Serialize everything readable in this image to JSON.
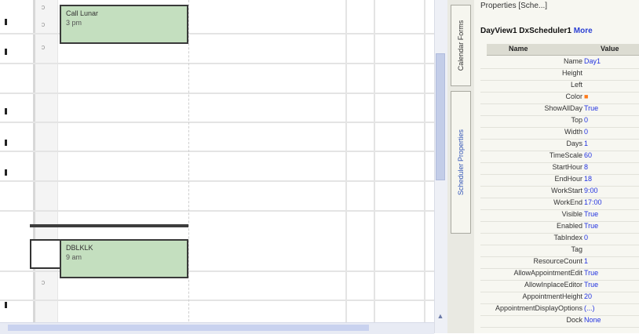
{
  "calendar": {
    "events": [
      {
        "title": "Call Lunar",
        "subtitle": "3 pm"
      },
      {
        "title": "DBLKLK",
        "subtitle": "9 am"
      }
    ],
    "time_glyphs": [
      "ↄ",
      "ↄ",
      "ↄ",
      "ↄ",
      "ↄ"
    ]
  },
  "tabs": {
    "tab1": "Calendar Forms",
    "tab2": "Scheduler Properties"
  },
  "panel": {
    "title": "Properties [Sche...] ",
    "header": "DayView1 DxScheduler1 ",
    "header_more": "More",
    "columns": [
      "Name",
      "Value"
    ],
    "rows": [
      {
        "k": "Name",
        "v": "Day1"
      },
      {
        "k": "Height",
        "v": ""
      },
      {
        "k": "Left",
        "v": ""
      },
      {
        "k": "Color",
        "v": "■"
      },
      {
        "k": "ShowAllDay",
        "v": "True"
      },
      {
        "k": "Top",
        "v": "0"
      },
      {
        "k": "Width",
        "v": "0"
      },
      {
        "k": "Days",
        "v": "1"
      },
      {
        "k": "TimeScale",
        "v": "60"
      },
      {
        "k": "StartHour",
        "v": "8"
      },
      {
        "k": "EndHour",
        "v": "18"
      },
      {
        "k": "WorkStart",
        "v": "9:00"
      },
      {
        "k": "WorkEnd",
        "v": "17:00"
      },
      {
        "k": "Visible",
        "v": "True"
      },
      {
        "k": "Enabled",
        "v": "True"
      },
      {
        "k": "TabIndex",
        "v": "0"
      },
      {
        "k": "Tag",
        "v": ""
      },
      {
        "k": "ResourceCount",
        "v": "1"
      },
      {
        "k": "AllowAppointmentEdit",
        "v": "True"
      },
      {
        "k": "AllowInplaceEditor",
        "v": "True"
      },
      {
        "k": "AppointmentHeight",
        "v": "20"
      },
      {
        "k": "AppointmentDisplayOptions",
        "v": "(...)"
      },
      {
        "k": "Dock",
        "v": "None"
      }
    ]
  },
  "colors": {
    "event_fill": "#c4dfbf",
    "link_blue": "#2333e0"
  },
  "icons": [
    "scroll-up-arrow-icon",
    "scroll-down-arrow-icon",
    "scroll-left-arrow-icon",
    "scroll-right-arrow-icon",
    "clock-icon"
  ]
}
